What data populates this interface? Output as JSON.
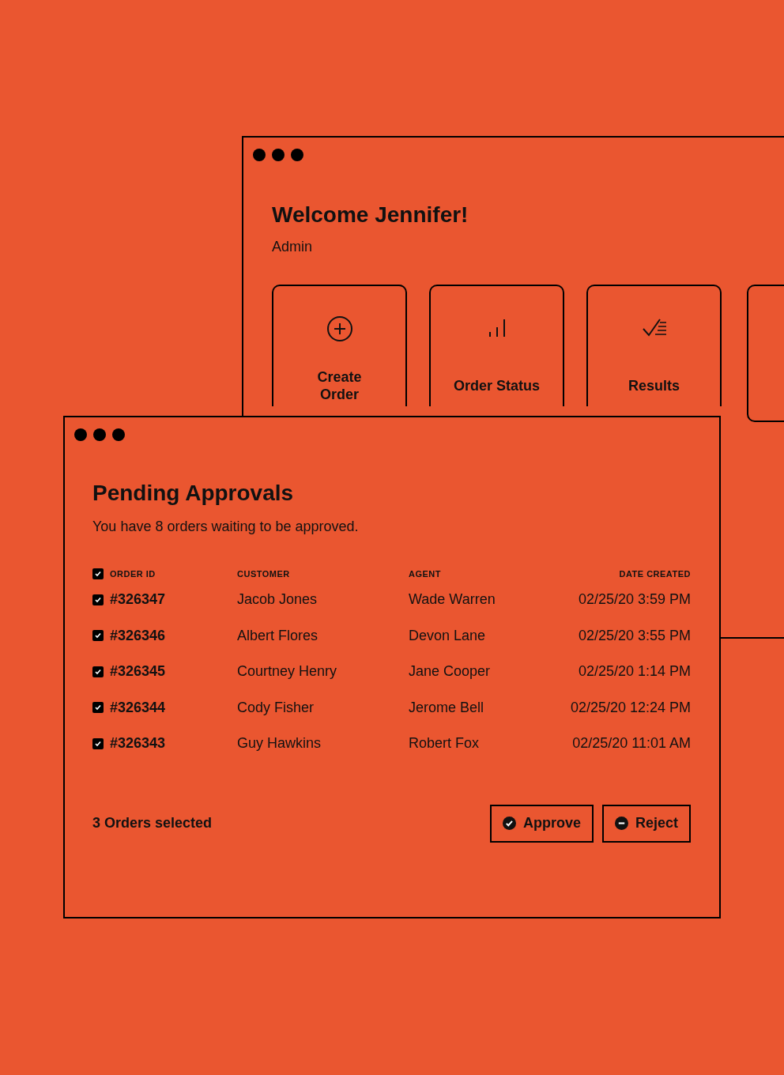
{
  "back_window": {
    "title": "Welcome Jennifer!",
    "role": "Admin",
    "tiles": [
      {
        "kind": "create",
        "label": "Create Order"
      },
      {
        "kind": "status",
        "label": "Order Status"
      },
      {
        "kind": "results",
        "label": "Results"
      },
      {
        "kind": "blank"
      }
    ]
  },
  "front_window": {
    "title": "Pending Approvals",
    "subtitle": "You have 8 orders waiting to be approved.",
    "table": {
      "select_all": {
        "checked": true
      },
      "columns": [
        "ORDER ID",
        "CUSTOMER",
        "AGENT",
        "DATE CREATED"
      ],
      "rows": [
        {
          "checked": true,
          "cells": [
            "#326347",
            "Jacob Jones",
            "Wade Warren",
            "02/25/20 3:59 PM"
          ]
        },
        {
          "checked": true,
          "cells": [
            "#326346",
            "Albert Flores",
            "Devon Lane",
            "02/25/20 3:55 PM"
          ]
        },
        {
          "checked": true,
          "cells": [
            "#326345",
            "Courtney Henry",
            "Jane Cooper",
            "02/25/20 1:14 PM"
          ]
        },
        {
          "checked": true,
          "cells": [
            "#326344",
            "Cody Fisher",
            "Jerome Bell",
            "02/25/20 12:24 PM"
          ]
        },
        {
          "checked": true,
          "cells": [
            "#326343",
            "Guy Hawkins",
            "Robert Fox",
            "02/25/20 11:01 AM"
          ]
        }
      ]
    },
    "selection_summary": "3 Orders selected",
    "buttons": [
      {
        "kind": "approve",
        "label": "Approve"
      },
      {
        "kind": "reject",
        "label": "Reject"
      }
    ]
  }
}
